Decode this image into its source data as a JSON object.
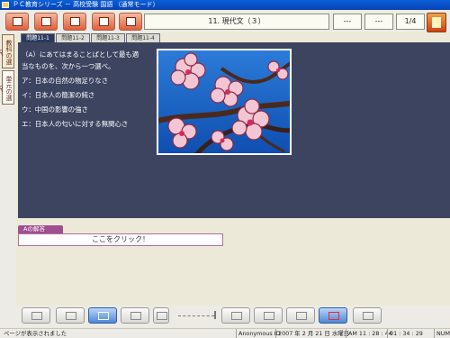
{
  "window": {
    "title": "ＰＣ教育シリーズ － 高校受験 国語 （通常モード）"
  },
  "header": {
    "title": "11. 現代文（３）",
    "box1": "---",
    "box2": "---",
    "page": "1/4"
  },
  "left_tabs": [
    "教科の選択",
    "単元の選択"
  ],
  "sub_tabs": [
    "問題11-1",
    "問題11-2",
    "問題11-3",
    "問題11-4"
  ],
  "question": {
    "lines": [
      "（A）にあてはまることばとして最も適",
      "当なものを、次から一つ選べ。",
      "ア：日本の自然の物足りなさ",
      "イ：日本人の簡潔の純さ",
      "ウ：中国の影響の強さ",
      "エ：日本人の匂いに対する無関心さ"
    ]
  },
  "answer": {
    "label": "Aの解答",
    "prompt": "ここをクリック！"
  },
  "status": {
    "message": "ページが表示されました",
    "user": "Anonymous ID",
    "date": "2007 年 2 月 21 日 水曜日",
    "time": "AM 11 : 28 : 44",
    "elapsed": "01 : 34 : 29",
    "num": "NUM"
  },
  "colors": {
    "panel": "#3c4460",
    "accent": "#e0603c",
    "answer_accent": "#a05090"
  }
}
